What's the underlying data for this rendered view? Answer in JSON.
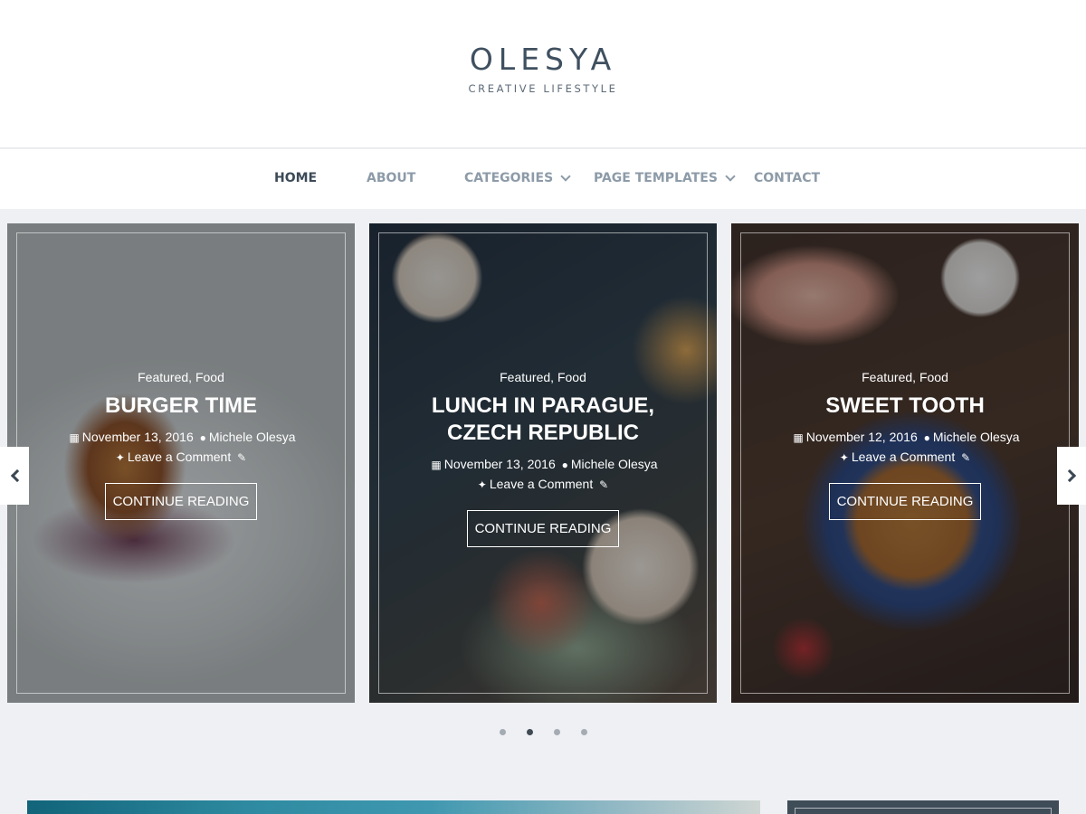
{
  "site": {
    "title": "OLESYA",
    "tagline": "CREATIVE LIFESTYLE"
  },
  "nav": {
    "items": [
      {
        "label": "HOME",
        "active": true
      },
      {
        "label": "ABOUT"
      },
      {
        "label": "CATEGORIES",
        "dropdown": true
      },
      {
        "label": "PAGE TEMPLATES",
        "dropdown": true
      },
      {
        "label": "CONTACT"
      }
    ]
  },
  "slider": {
    "slides": [
      {
        "categories": "Featured, Food",
        "title": "BURGER TIME",
        "date": "November 13, 2016",
        "author": "Michele Olesya",
        "comments": "Leave a Comment",
        "button": "CONTINUE READING",
        "icons": [
          "calendar-icon",
          "user-icon",
          "comment-icon",
          "edit-icon"
        ]
      },
      {
        "categories": "Featured, Food",
        "title": "LUNCH IN PARAGUE, CZECH REPUBLIC",
        "date": "November 13, 2016",
        "author": "Michele Olesya",
        "comments": "Leave a Comment",
        "button": "CONTINUE READING",
        "icons": [
          "calendar-icon",
          "user-icon",
          "comment-icon",
          "edit-icon"
        ]
      },
      {
        "categories": "Featured, Food",
        "title": "SWEET TOOTH",
        "date": "November 12, 2016",
        "author": "Michele Olesya",
        "comments": "Leave a Comment",
        "button": "CONTINUE READING",
        "icons": [
          "calendar-icon",
          "user-icon",
          "comment-icon",
          "edit-icon"
        ]
      }
    ],
    "arrows": [
      "chevron-left-icon",
      "chevron-right-icon"
    ],
    "dots": {
      "count": 4,
      "active_index": 1
    }
  },
  "colors": {
    "page_bg": "#eff0f4",
    "nav_active": "#3c4a57",
    "nav_inactive": "#8d9ba8",
    "title": "#3f5060"
  }
}
